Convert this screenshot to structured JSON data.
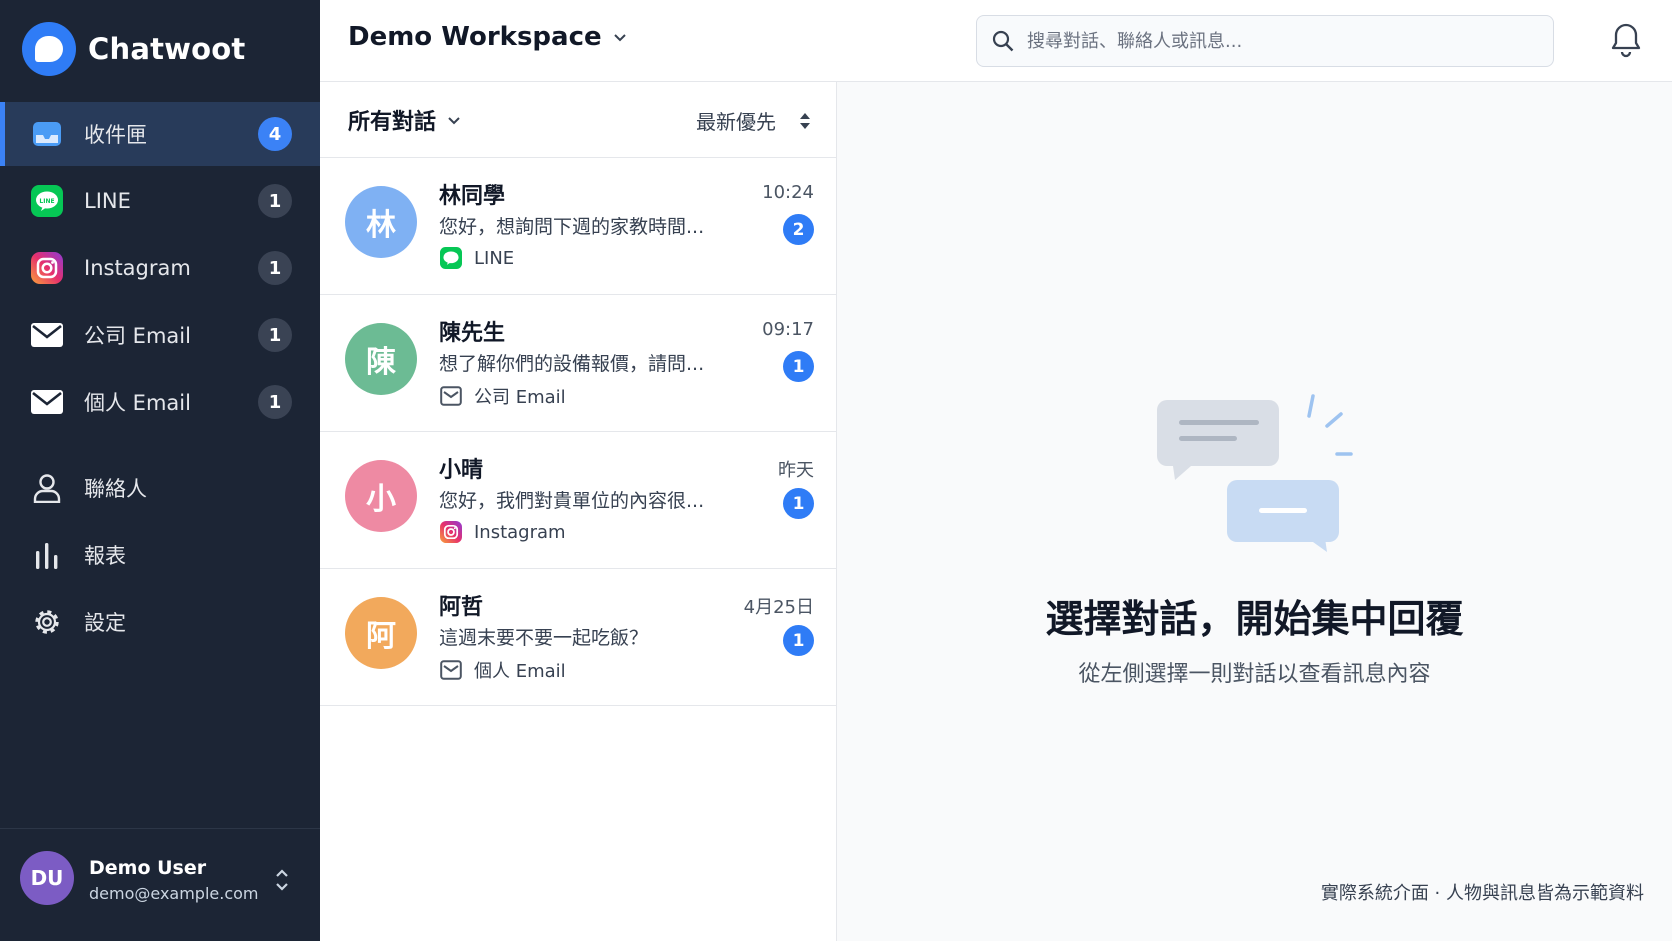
{
  "brand": {
    "name": "Chatwoot",
    "logo_icon": "chat-bubble-icon"
  },
  "nav": {
    "inbox_items": [
      {
        "label": "收件匣",
        "count": "4",
        "icon": "inbox-icon",
        "active": true
      },
      {
        "label": "LINE",
        "count": "1",
        "icon": "line-icon"
      },
      {
        "label": "Instagram",
        "count": "1",
        "icon": "instagram-icon"
      },
      {
        "label": "公司 Email",
        "count": "1",
        "icon": "mail-icon"
      },
      {
        "label": "個人 Email",
        "count": "1",
        "icon": "mail-icon"
      }
    ],
    "main_items": [
      {
        "label": "聯絡人",
        "icon": "person-icon"
      },
      {
        "label": "報表",
        "icon": "bar-chart-icon"
      },
      {
        "label": "設定",
        "icon": "gear-icon"
      }
    ]
  },
  "user": {
    "initials": "DU",
    "name": "Demo User",
    "email": "demo@example.com"
  },
  "topbar": {
    "workspace": "Demo Workspace",
    "search_placeholder": "搜尋對話、聯絡人或訊息..."
  },
  "list": {
    "filter": "所有對話",
    "sort": "最新優先",
    "conversations": [
      {
        "initial": "林",
        "avatar_color": "#7fb1f3",
        "name": "林同學",
        "preview": "您好，想詢問下週的家教時間...",
        "channel": "LINE",
        "channel_icon": "line-icon",
        "time": "10:24",
        "unread": "2"
      },
      {
        "initial": "陳",
        "avatar_color": "#6cbb94",
        "name": "陳先生",
        "preview": "想了解你們的設備報價，請問...",
        "channel": "公司 Email",
        "channel_icon": "mail-icon",
        "time": "09:17",
        "unread": "1"
      },
      {
        "initial": "小",
        "avatar_color": "#ee8aa3",
        "name": "小晴",
        "preview": "您好，我們對貴單位的內容很...",
        "channel": "Instagram",
        "channel_icon": "instagram-icon",
        "time": "昨天",
        "unread": "1"
      },
      {
        "initial": "阿",
        "avatar_color": "#f2a95c",
        "name": "阿哲",
        "preview": "這週末要不要一起吃飯？",
        "channel": "個人 Email",
        "channel_icon": "mail-icon",
        "time": "4月25日",
        "unread": "1"
      }
    ]
  },
  "empty_state": {
    "title": "選擇對話，開始集中回覆",
    "subtitle": "從左側選擇一則對話以查看訊息內容"
  },
  "footnote": "實際系統介面 · 人物與訊息皆為示範資料",
  "colors": {
    "sidebar": "#1c2535",
    "accent": "#3b82f6",
    "line_green": "#06c755"
  }
}
